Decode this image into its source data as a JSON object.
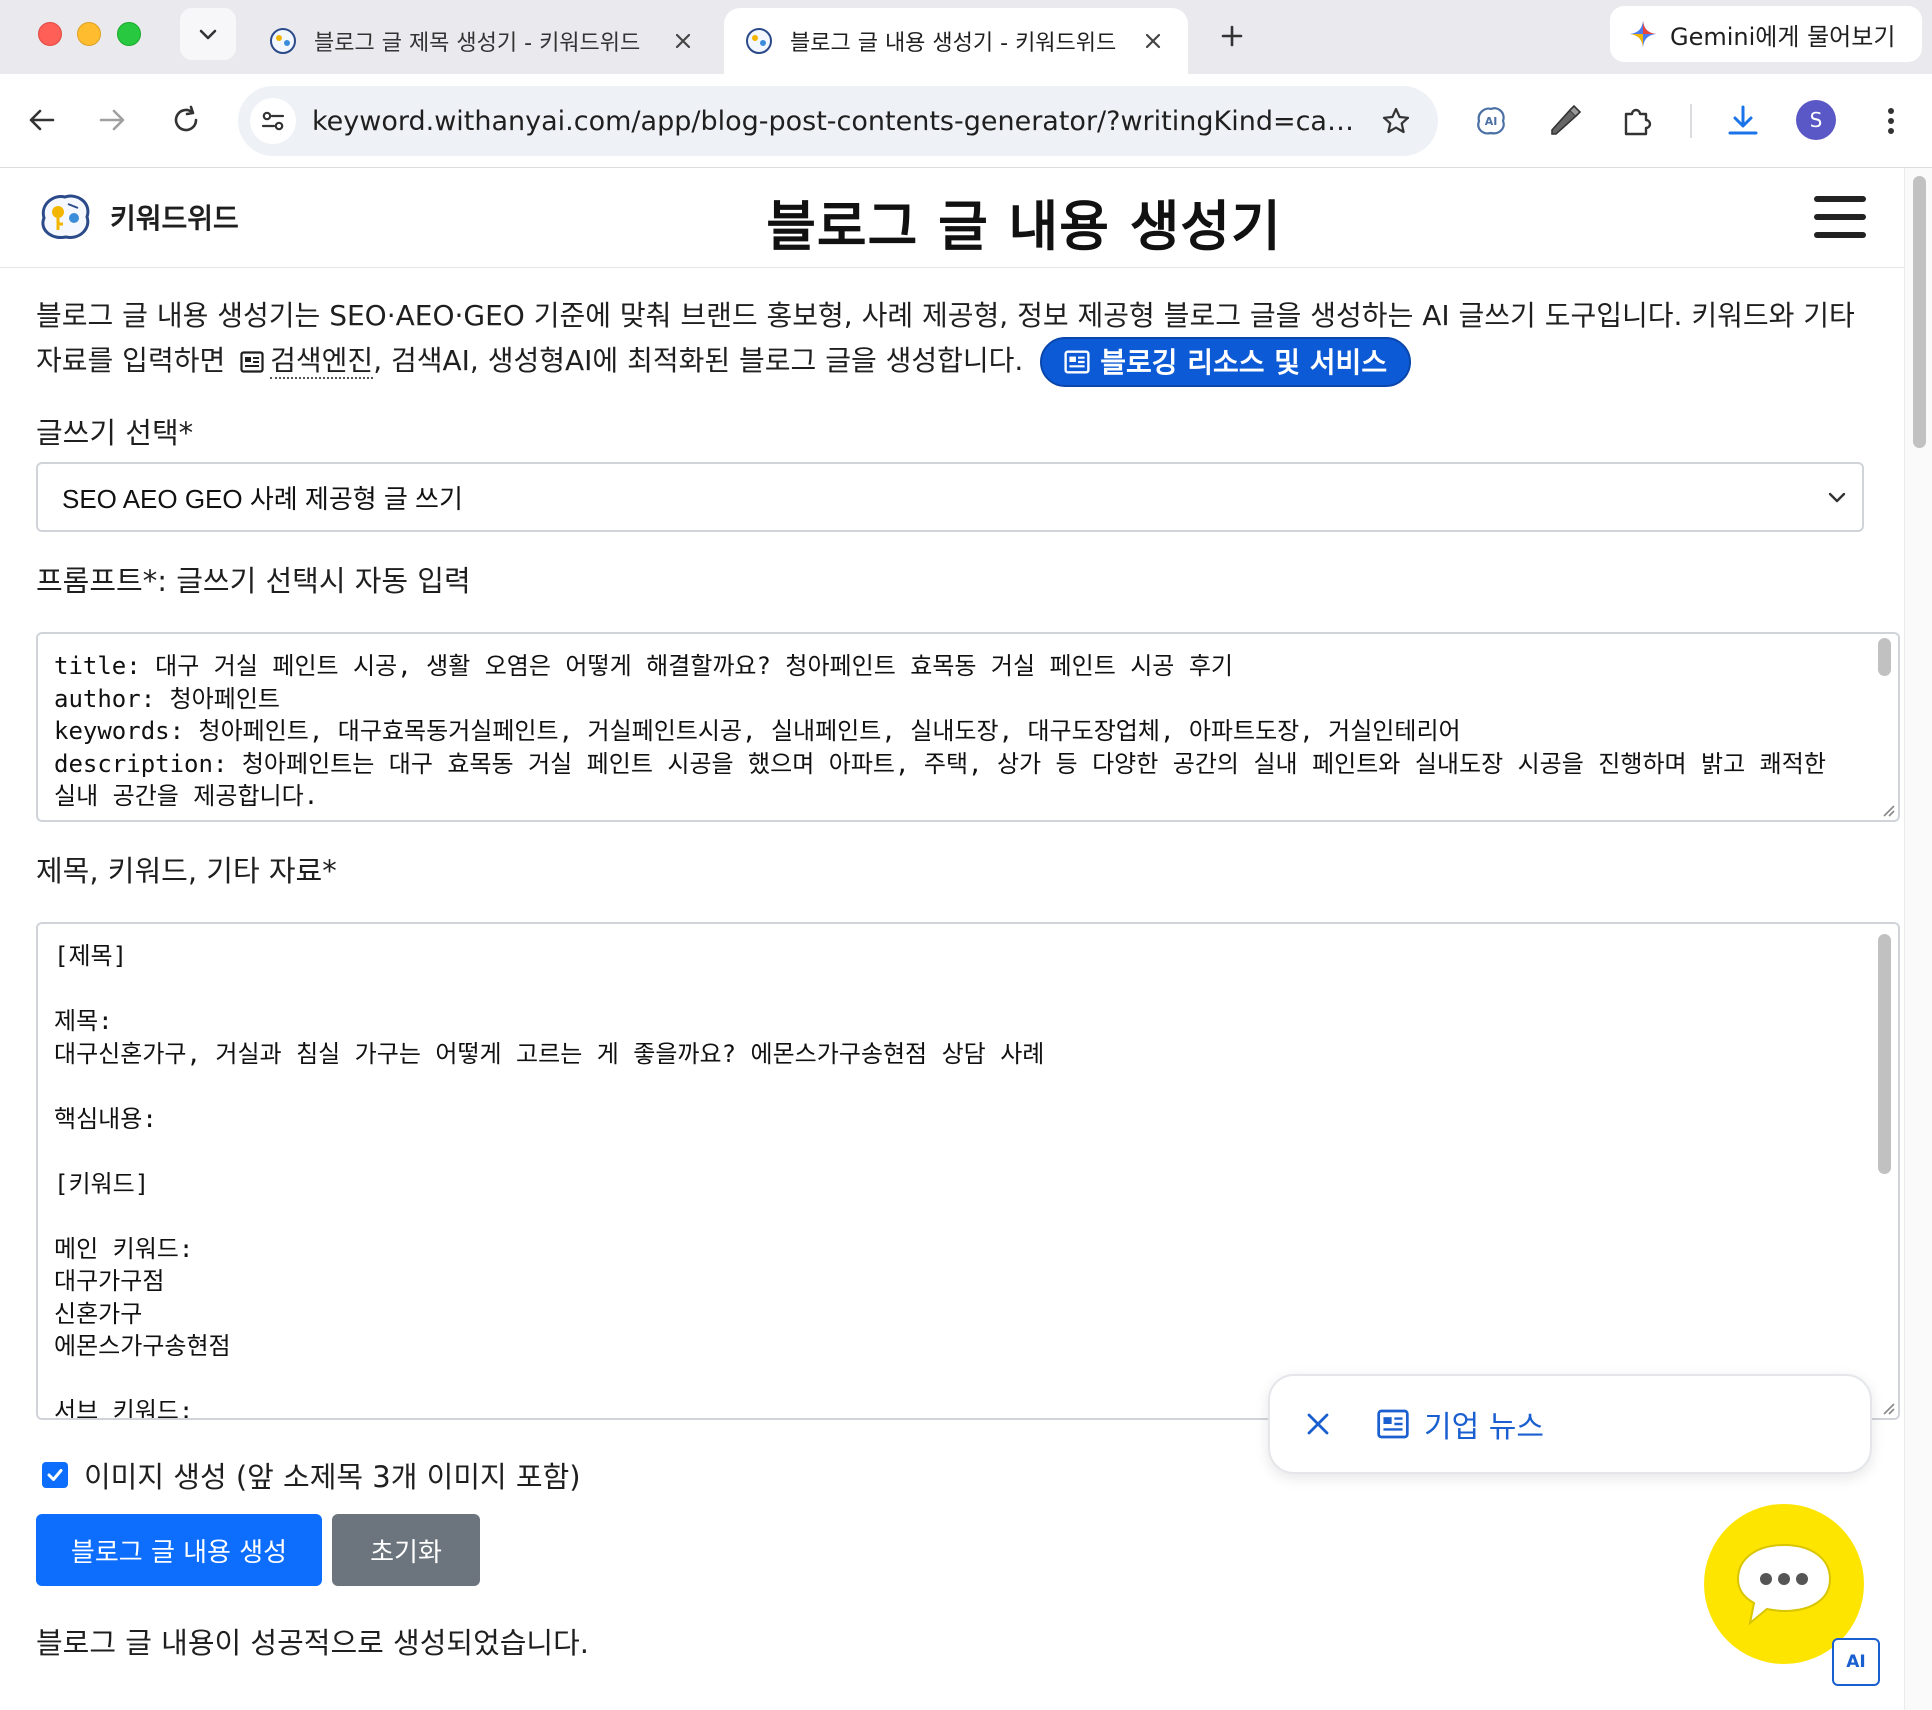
{
  "browser": {
    "tabs": [
      {
        "title": "블로그 글 제목 생성기 - 키워드위드",
        "active": false
      },
      {
        "title": "블로그 글 내용 생성기 - 키워드위드",
        "active": true
      }
    ],
    "gemini_label": "Gemini에게 물어보기",
    "url": "keyword.withanyai.com/app/blog-post-contents-generator/?writingKind=cas...",
    "profile_initial": "S"
  },
  "header": {
    "brand": "키워드위드",
    "page_title": "블로그 글 내용 생성기"
  },
  "intro": {
    "text_before": "블로그 글 내용 생성기는 SEO·AEO·GEO 기준에 맞춰 브랜드 홍보형, 사례 제공형, 정보 제공형 블로그 글을 생성하는 AI 글쓰기 도구입니다. 키워드와 기타 자료를 입력하면",
    "link_text": "검색엔진",
    "text_after": ", 검색AI, 생성형AI에 최적화된 블로그 글을 생성합니다.",
    "pill_label": "블로깅 리소스 및 서비스"
  },
  "form": {
    "writer_label": "글쓰기 선택*",
    "writer_selected": "SEO AEO GEO 사례 제공형 글 쓰기",
    "prompt_label": "프롬프트*: 글쓰기 선택시 자동 입력",
    "prompt_lines": [
      "title: 대구 거실 페인트 시공, 생활 오염은 어떻게 해결할까요? 청아페인트 효목동 거실 페인트 시공 후기",
      "author: 청아페인트",
      "keywords: 청아페인트, 대구효목동거실페인트, 거실페인트시공, 실내페인트, 실내도장, 대구도장업체, 아파트도장, 거실인테리어",
      "description: 청아페인트는 대구 효목동 거실 페인트 시공을 했으며 아파트, 주택, 상가 등 다양한 공간의 실내 페인트와 실내도장 시공을 진행하며 밝고 쾌적한 실내 공간을 제공합니다."
    ],
    "materials_label": "제목, 키워드, 기타 자료*",
    "materials_lines": [
      "[제목]",
      "",
      "제목:",
      "대구신혼가구, 거실과 침실 가구는 어떻게 고르는 게 좋을까요? 에몬스가구송현점 상담 사례",
      "",
      "핵심내용:",
      "",
      "[키워드]",
      "",
      "메인 키워드:",
      "대구가구점",
      "신혼가구",
      "에몬스가구송현점",
      "",
      "서브 키워드:"
    ],
    "image_checkbox_label": "이미지 생성 (앞 소제목 3개 이미지 포함)",
    "image_checkbox_checked": true,
    "generate_button": "블로그 글 내용 생성",
    "reset_button": "초기화",
    "status_message": "블로그 글 내용이 성공적으로 생성되었습니다."
  },
  "popup": {
    "label": "기업 뉴스"
  },
  "badge": {
    "ai_text": "AI"
  },
  "colors": {
    "primary": "#0d6efd",
    "pill": "#0d5ad6",
    "secondary": "#6c757d",
    "chat_bubble": "#fde500",
    "link_blue": "#1a5fd0"
  }
}
